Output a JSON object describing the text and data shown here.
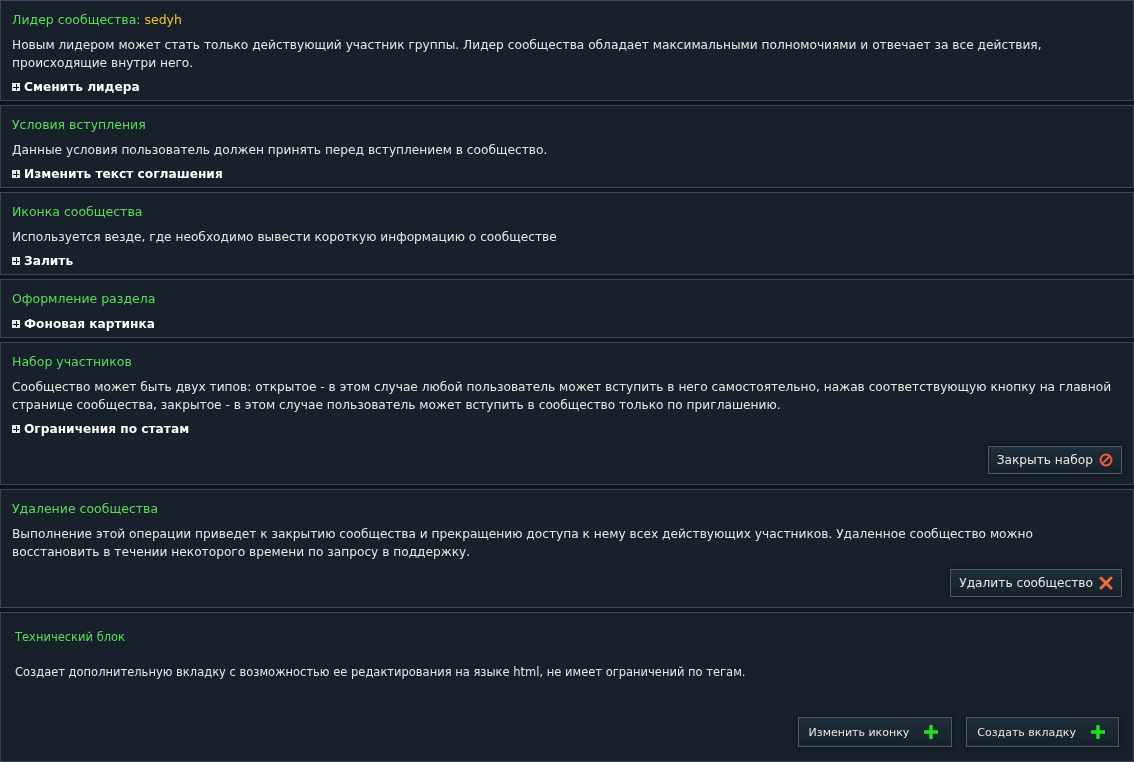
{
  "sections": [
    {
      "title": "Лидер сообщества:",
      "leader": "sedyh",
      "description": "Новым лидером может стать только действующий участник группы. Лидер сообщества обладает максимальными полномочиями и отвечает за все действия, происходящие внутри него.",
      "links": [
        "Сменить лидера"
      ]
    },
    {
      "title": "Условия вступления",
      "description": "Данные условия пользователь должен принять перед вступлением в сообщество.",
      "links": [
        "Изменить текст соглашения"
      ]
    },
    {
      "title": "Иконка сообщества",
      "description": "Используется везде, где необходимо вывести короткую информацию о сообществе",
      "links": [
        "Залить"
      ]
    },
    {
      "title": "Оформление раздела",
      "links": [
        "Фоновая картинка"
      ]
    },
    {
      "title": "Набор участников",
      "description": "Сообщество может быть двух типов: открытое - в этом случае любой пользователь может вступить в него самостоятельно, нажав соответствующую кнопку на главной странице сообщества, закрытое - в этом случае пользователь может вступить в сообщество только по приглашению.",
      "links": [
        "Ограничения по статам"
      ],
      "buttons": [
        {
          "label": "Закрыть набор",
          "kind": "forbid"
        }
      ]
    },
    {
      "title": "Удаление сообщества",
      "description": "Выполнение этой операции приведет к закрытию сообщества и прекращению доступа к нему всех действующих участников. Удаленное сообщество можно восстановить в течении некоторого времени по запросу в поддержку.",
      "buttons": [
        {
          "label": "Удалить сообщество",
          "kind": "cross"
        }
      ]
    },
    {
      "title": "Технический блок",
      "kind": "technical",
      "description": "Создает дополнительную вкладку с возможностью ее редактирования на языке html, не имеет ограничений по тегам.",
      "buttons": [
        {
          "label": "Изменить иконку",
          "kind": "plus"
        },
        {
          "label": "Создать вкладку",
          "kind": "plus"
        }
      ]
    }
  ]
}
